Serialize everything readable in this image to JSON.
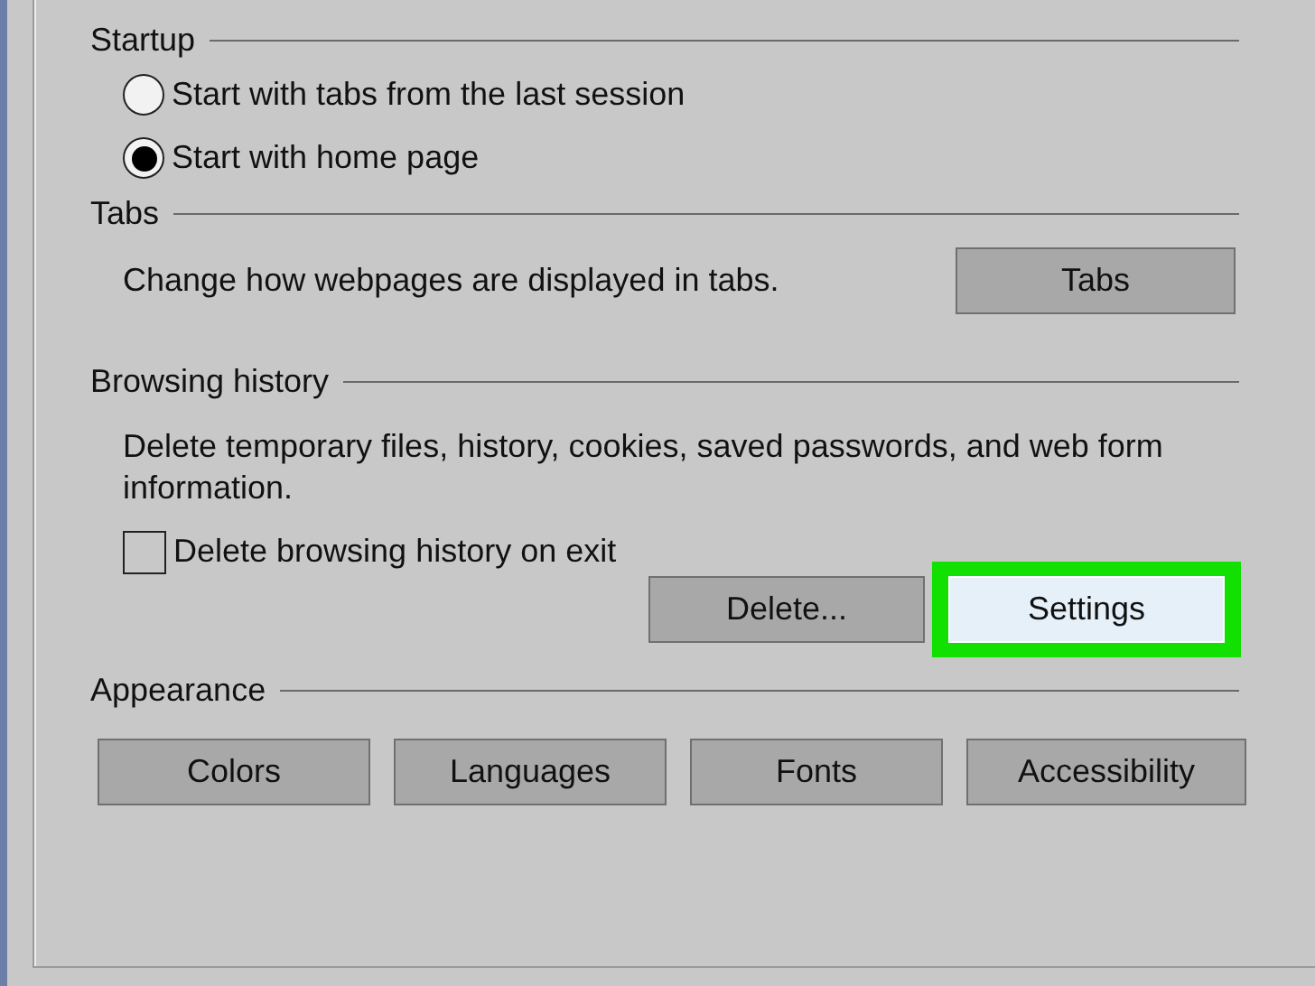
{
  "sections": [
    {
      "kind": "radios",
      "title": "Startup",
      "options": [
        {
          "label": "Start with tabs from the last session",
          "selected": false
        },
        {
          "label": "Start with home page",
          "selected": true
        }
      ]
    },
    {
      "kind": "description",
      "title": "Tabs",
      "text": "Change how webpages are displayed in tabs.",
      "buttons": [
        {
          "label": "Tabs",
          "highlighted": false
        }
      ]
    },
    {
      "kind": "history",
      "title": "Browsing history",
      "text": "Delete temporary files, history, cookies, saved passwords, and web form information.",
      "checkbox": {
        "label": "Delete browsing history on exit",
        "checked": false
      },
      "buttons": [
        {
          "label": "Delete...",
          "highlighted": false
        },
        {
          "label": "Settings",
          "highlighted": true
        }
      ]
    },
    {
      "kind": "buttons",
      "title": "Appearance",
      "buttons": [
        {
          "label": "Colors",
          "highlighted": false
        },
        {
          "label": "Languages",
          "highlighted": false
        },
        {
          "label": "Fonts",
          "highlighted": false
        },
        {
          "label": "Accessibility",
          "highlighted": false
        }
      ]
    }
  ]
}
